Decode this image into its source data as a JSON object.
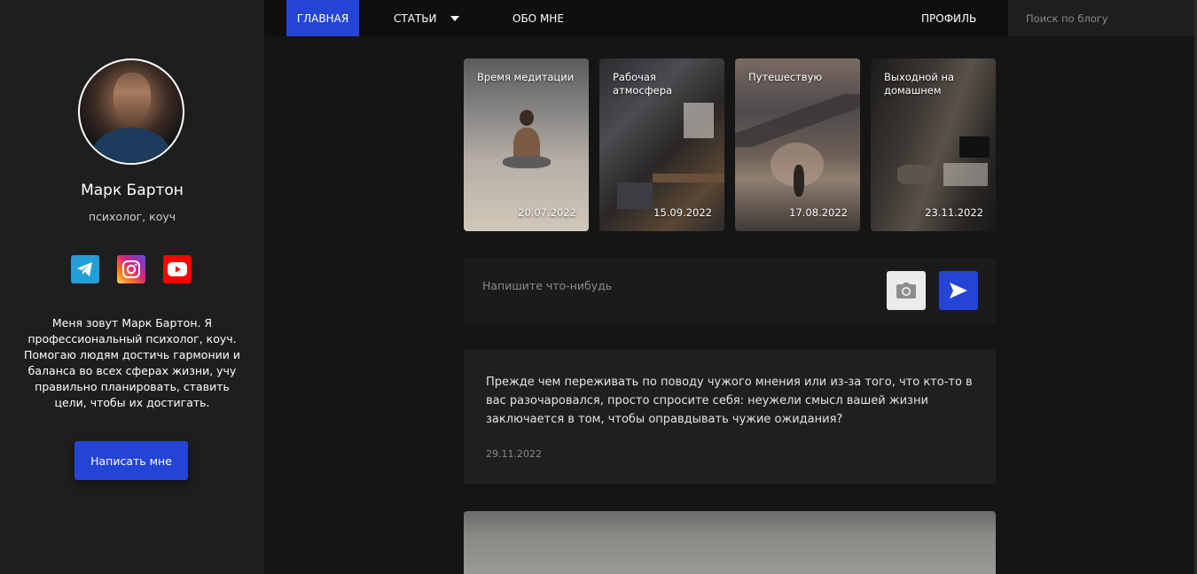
{
  "sidebar": {
    "name": "Марк Бартон",
    "role": "психолог, коуч",
    "socials": [
      {
        "name": "telegram",
        "icon": "telegram-icon",
        "color": "#229ed9"
      },
      {
        "name": "instagram",
        "icon": "instagram-icon",
        "color": "#d62976"
      },
      {
        "name": "youtube",
        "icon": "youtube-icon",
        "color": "#ff0000"
      }
    ],
    "bio": "Меня зовут Марк Бартон. Я профессиональный психолог, коуч. Помогаю людям достичь гармонии и баланса во всех сферах жизни, учу правильно планировать, ставить цели, чтобы их достигать.",
    "write_button": "Написать мне"
  },
  "nav": {
    "home": "ГЛАВНАЯ",
    "articles": "СТАТЬИ",
    "about": "ОБО МНЕ",
    "profile": "ПРОФИЛЬ",
    "search_placeholder": "Поиск по блогу"
  },
  "stories": [
    {
      "title": "Время медитации",
      "date": "20.07.2022"
    },
    {
      "title": "Рабочая атмосфера",
      "date": "15.09.2022"
    },
    {
      "title": "Путешествую",
      "date": "17.08.2022"
    },
    {
      "title": "Выходной на домашнем",
      "date": "23.11.2022"
    }
  ],
  "composer": {
    "placeholder": "Напишите что-нибудь"
  },
  "post": {
    "text": "Прежде чем переживать по поводу чужого мнения или из-за того, что кто-то в вас разочаровался, просто спросите себя: неужели смысл вашей жизни заключается в том, чтобы оправдывать чужие ожидания?",
    "date": "29.11.2022"
  },
  "colors": {
    "accent": "#2444d6",
    "background": "#151515",
    "sidebar": "#1e1e1e"
  }
}
